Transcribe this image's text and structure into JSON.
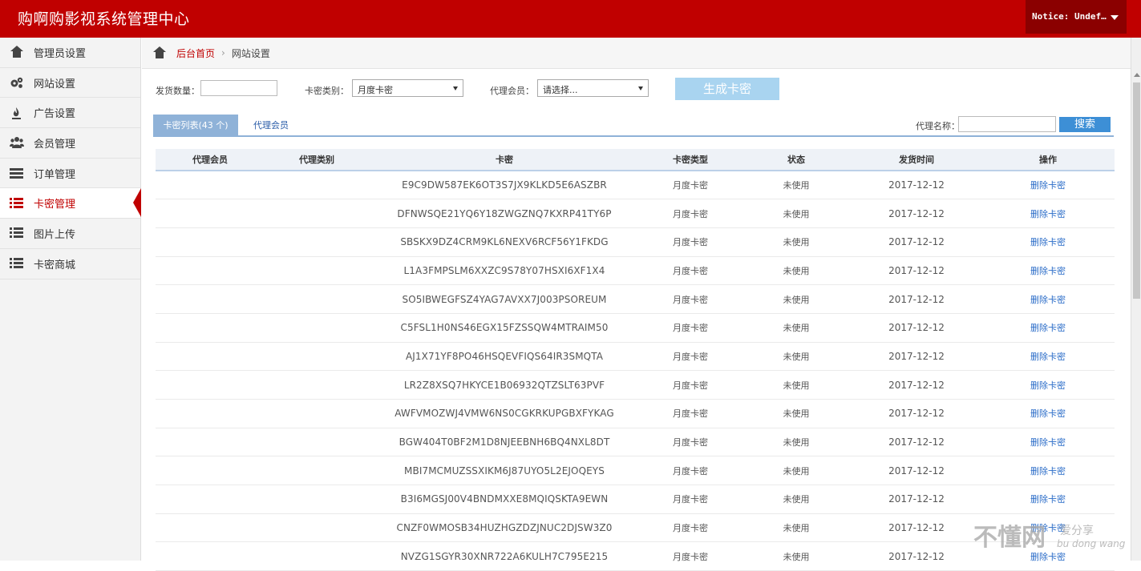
{
  "header": {
    "title": "购啊购影视系统管理中心",
    "notice": "Notice: Undef…"
  },
  "sidebar": {
    "items": [
      {
        "label": "管理员设置",
        "icon": "home-icon"
      },
      {
        "label": "网站设置",
        "icon": "gears-icon"
      },
      {
        "label": "广告设置",
        "icon": "fire-icon"
      },
      {
        "label": "会员管理",
        "icon": "users-icon"
      },
      {
        "label": "订单管理",
        "icon": "list-alt-icon"
      },
      {
        "label": "卡密管理",
        "icon": "list-icon",
        "active": true
      },
      {
        "label": "图片上传",
        "icon": "list-icon"
      },
      {
        "label": "卡密商城",
        "icon": "list-icon"
      }
    ]
  },
  "breadcrumb": {
    "home": "后台首页",
    "separator": "›",
    "current": "网站设置"
  },
  "form": {
    "qty_label": "发货数量：",
    "qty_value": "",
    "type_label": "卡密类别：",
    "type_selected": "月度卡密",
    "agent_label": "代理会员：",
    "agent_selected": "请选择...",
    "generate_button": "生成卡密"
  },
  "tabs": {
    "card_list": "卡密列表(43 个)",
    "agents": "代理会员"
  },
  "search": {
    "label": "代理名称：",
    "value": "",
    "button": "搜索"
  },
  "table": {
    "columns": [
      "代理会员",
      "代理类别",
      "卡密",
      "卡密类型",
      "状态",
      "发货时间",
      "操作"
    ],
    "rows": [
      {
        "agent": "",
        "agent_type": "",
        "code": "E9C9DW587EK6OT3S7JX9KLKD5E6ASZBR",
        "card_type": "月度卡密",
        "status": "未使用",
        "date": "2017-12-12",
        "action": "删除卡密"
      },
      {
        "agent": "",
        "agent_type": "",
        "code": "DFNWSQE21YQ6Y18ZWGZNQ7KXRP41TY6P",
        "card_type": "月度卡密",
        "status": "未使用",
        "date": "2017-12-12",
        "action": "删除卡密"
      },
      {
        "agent": "",
        "agent_type": "",
        "code": "SBSKX9DZ4CRM9KL6NEXV6RCF56Y1FKDG",
        "card_type": "月度卡密",
        "status": "未使用",
        "date": "2017-12-12",
        "action": "删除卡密"
      },
      {
        "agent": "",
        "agent_type": "",
        "code": "L1A3FMPSLM6XXZC9S78Y07HSXI6XF1X4",
        "card_type": "月度卡密",
        "status": "未使用",
        "date": "2017-12-12",
        "action": "删除卡密"
      },
      {
        "agent": "",
        "agent_type": "",
        "code": "SO5IBWEGFSZ4YAG7AVXX7J003PSOREUM",
        "card_type": "月度卡密",
        "status": "未使用",
        "date": "2017-12-12",
        "action": "删除卡密"
      },
      {
        "agent": "",
        "agent_type": "",
        "code": "C5FSL1H0NS46EGX15FZSSQW4MTRAIM50",
        "card_type": "月度卡密",
        "status": "未使用",
        "date": "2017-12-12",
        "action": "删除卡密"
      },
      {
        "agent": "",
        "agent_type": "",
        "code": "AJ1X71YF8PO46HSQEVFIQS64IR3SMQTA",
        "card_type": "月度卡密",
        "status": "未使用",
        "date": "2017-12-12",
        "action": "删除卡密"
      },
      {
        "agent": "",
        "agent_type": "",
        "code": "LR2Z8XSQ7HKYCE1B06932QTZSLT63PVF",
        "card_type": "月度卡密",
        "status": "未使用",
        "date": "2017-12-12",
        "action": "删除卡密"
      },
      {
        "agent": "",
        "agent_type": "",
        "code": "AWFVMOZWJ4VMW6NS0CGKRKUPGBXFYKAG",
        "card_type": "月度卡密",
        "status": "未使用",
        "date": "2017-12-12",
        "action": "删除卡密"
      },
      {
        "agent": "",
        "agent_type": "",
        "code": "BGW404T0BF2M1D8NJEEBNH6BQ4NXL8DT",
        "card_type": "月度卡密",
        "status": "未使用",
        "date": "2017-12-12",
        "action": "删除卡密"
      },
      {
        "agent": "",
        "agent_type": "",
        "code": "MBI7MCMUZSSXIKM6J87UYO5L2EJOQEYS",
        "card_type": "月度卡密",
        "status": "未使用",
        "date": "2017-12-12",
        "action": "删除卡密"
      },
      {
        "agent": "",
        "agent_type": "",
        "code": "B3I6MGSJ00V4BNDMXXE8MQIQSKTA9EWN",
        "card_type": "月度卡密",
        "status": "未使用",
        "date": "2017-12-12",
        "action": "删除卡密"
      },
      {
        "agent": "",
        "agent_type": "",
        "code": "CNZF0WMOSB34HUZHGZDZJNUC2DJSW3Z0",
        "card_type": "月度卡密",
        "status": "未使用",
        "date": "2017-12-12",
        "action": "删除卡密"
      },
      {
        "agent": "",
        "agent_type": "",
        "code": "NVZG1SGYR30XNR722A6KULH7C795E215",
        "card_type": "月度卡密",
        "status": "未使用",
        "date": "2017-12-12",
        "action": "删除卡密"
      }
    ]
  },
  "watermark": {
    "main": "不懂网",
    "sub": "爱分享",
    "pinyin": "bu dong wang"
  },
  "colors": {
    "brand_red": "#c00000",
    "accent_blue": "#3d8fd6",
    "tab_blue": "#8fb2d8",
    "link_blue": "#2a6cc8"
  }
}
